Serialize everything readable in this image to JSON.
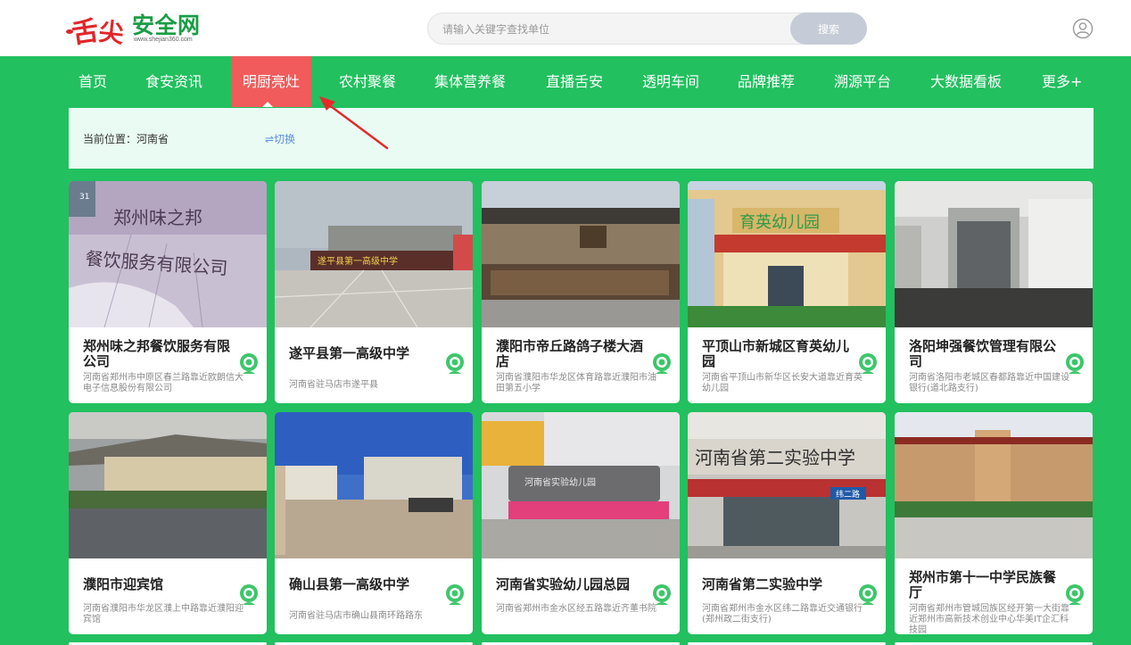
{
  "header": {
    "logo_name": "安全网",
    "logo_mark": "舌尖",
    "logo_url": "www.shejian360.com",
    "search_placeholder": "请输入关键字查找单位",
    "search_button": "搜索"
  },
  "nav": {
    "items": [
      "首页",
      "食安资讯",
      "明厨亮灶",
      "农村聚餐",
      "集体营养餐",
      "直播舌安",
      "透明车间",
      "品牌推荐",
      "溯源平台",
      "大数据看板",
      "更多+"
    ],
    "active": "明厨亮灶"
  },
  "location": {
    "label": "当前位置：河南省",
    "switch": "⇌切换"
  },
  "colors": {
    "brand_green": "#22c05f",
    "active_red": "#f15b5b",
    "location_bg": "#e9fbf2",
    "pin_green": "#3dc66b"
  },
  "cards": [
    {
      "title": "郑州味之邦餐饮服务有限公司",
      "address": "河南省郑州市中原区春兰路靠近欧朗信大电子信息股份有限公司"
    },
    {
      "title": "遂平县第一高级中学",
      "address": "河南省驻马店市遂平县"
    },
    {
      "title": "濮阳市帝丘路鸽子楼大酒店",
      "address": "河南省濮阳市华龙区体育路靠近濮阳市油田第五小学"
    },
    {
      "title": "平顶山市新城区育英幼儿园",
      "address": "河南省平顶山市新华区长安大道靠近育英幼儿园"
    },
    {
      "title": "洛阳坤强餐饮管理有限公司",
      "address": "河南省洛阳市老城区春都路靠近中国建设银行(道北路支行)"
    },
    {
      "title": "濮阳市迎宾馆",
      "address": "河南省濮阳市华龙区濮上中路靠近濮阳迎宾馆"
    },
    {
      "title": "确山县第一高级中学",
      "address": "河南省驻马店市确山县南环路路东"
    },
    {
      "title": "河南省实验幼儿园总园",
      "address": "河南省郑州市金水区经五路靠近齐董书院"
    },
    {
      "title": "河南省第二实验中学",
      "address": "河南省郑州市金水区纬二路靠近交通银行(郑州政二街支行)"
    },
    {
      "title": "郑州市第十一中学民族餐厅",
      "address": "河南省郑州市管城回族区经开第一大街靠近郑州市高新技术创业中心华美IT企汇科技园"
    }
  ],
  "image_signs": {
    "card1": "郑州味之邦 餐饮服务有限公司",
    "card2": "遂平县第一高级中学",
    "card4": "育英幼儿园",
    "card8": "河南省实验幼儿园",
    "card9": "河南省第二实验中学",
    "card9_street": "纬二路"
  }
}
